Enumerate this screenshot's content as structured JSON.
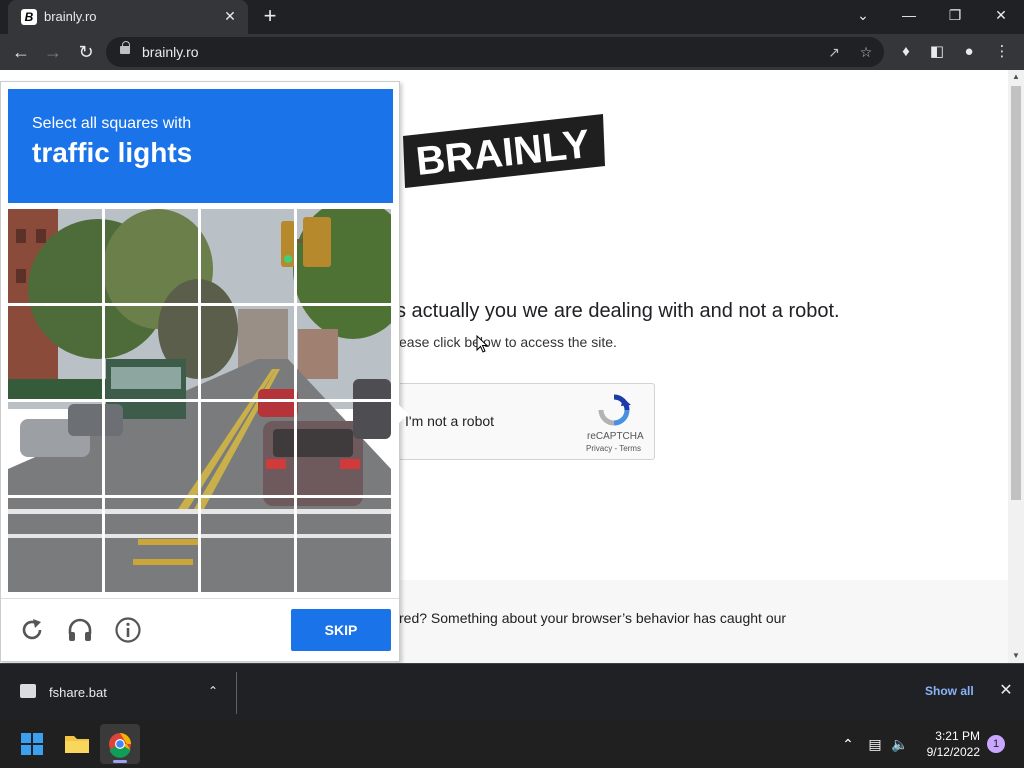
{
  "browser": {
    "tab_title": "brainly.ro",
    "tab_favicon": "B",
    "url": "brainly.ro",
    "new_tab_icon": "+",
    "close_icon": "✕"
  },
  "page": {
    "logo_text": "BRAINLY",
    "heading": "s actually you we are dealing with and not a robot.",
    "subtext": "ease click below to access the site.",
    "recaptcha_checkbox_label": "I'm not a robot",
    "recaptcha_brand": "reCAPTCHA",
    "recaptcha_links": "Privacy - Terms",
    "footer_text": "red? Something about your browser’s behavior has caught our"
  },
  "challenge": {
    "instruction_small": "Select all squares with",
    "instruction_big": "traffic lights",
    "skip_label": "SKIP",
    "grid_rows": 4,
    "grid_cols": 4
  },
  "downloads": {
    "file_name": "fshare.bat",
    "show_all_label": "Show all"
  },
  "taskbar": {
    "time": "3:21 PM",
    "date": "9/12/2022",
    "notification_count": "1"
  },
  "colors": {
    "accent_blue": "#1a73e8",
    "chrome_dark": "#202124",
    "chrome_toolbar": "#35363a"
  }
}
